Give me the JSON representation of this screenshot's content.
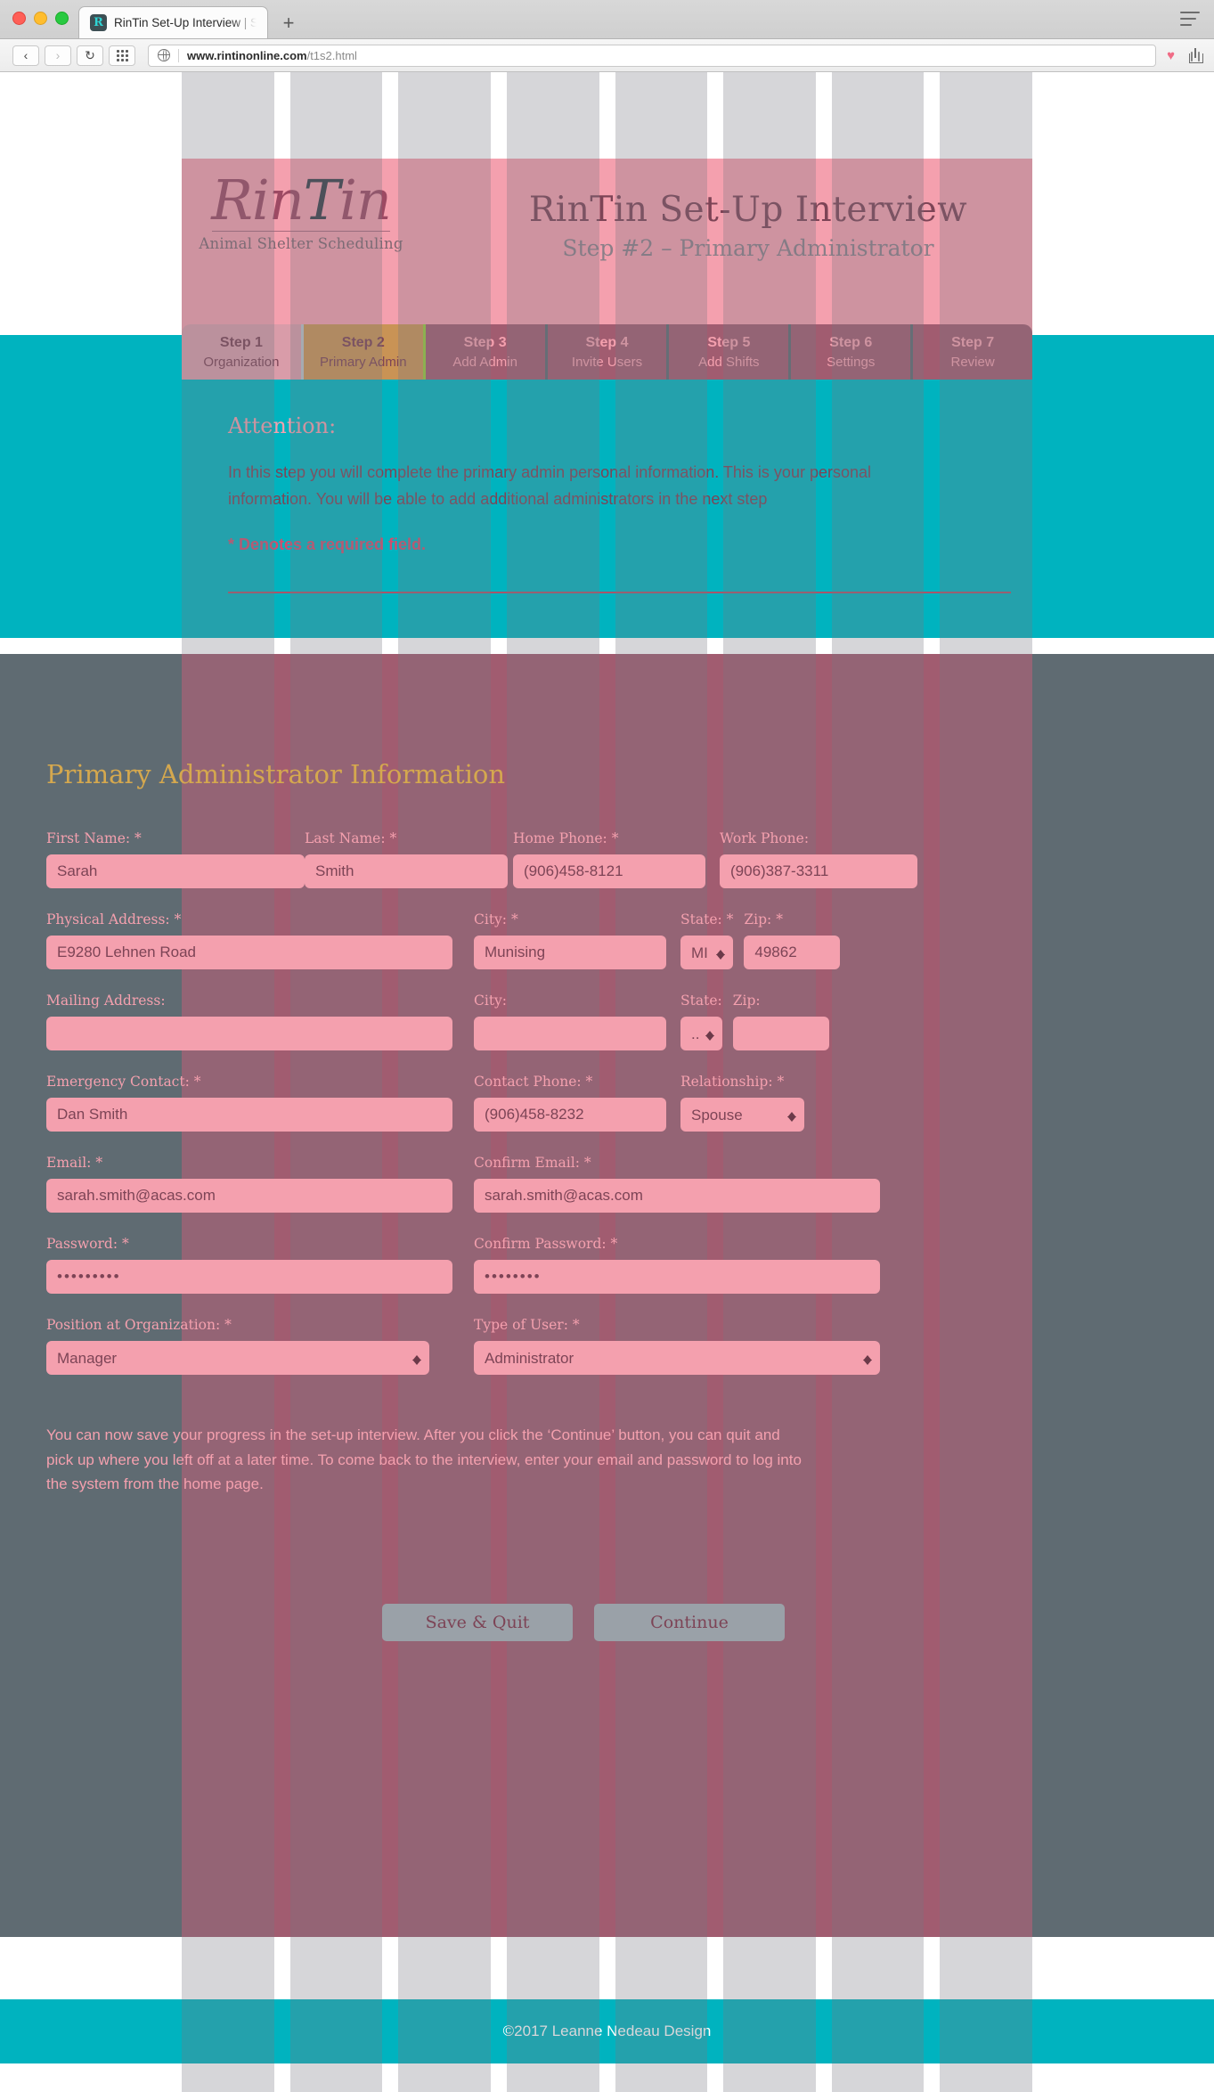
{
  "browser": {
    "tab_title": "RinTin Set-Up Interview | Step",
    "favicon_letter": "R",
    "new_tab_label": "+",
    "back_label": "‹",
    "forward_label": "›",
    "reload_label": "↻",
    "url_domain": "www.rintinonline.com",
    "url_path": "/t1s2.html",
    "bookmark_icon": "♥"
  },
  "header": {
    "logo_text": "RinTin",
    "logo_tagline": "Animal Shelter Scheduling",
    "title": "RinTin Set-Up Interview",
    "subtitle": "Step #2 – Primary Administrator"
  },
  "steps": [
    {
      "num": "Step 1",
      "label": "Organization",
      "state": "done"
    },
    {
      "num": "Step 2",
      "label": "Primary Admin",
      "state": "active"
    },
    {
      "num": "Step 3",
      "label": "Add Admin",
      "state": "todo"
    },
    {
      "num": "Step 4",
      "label": "Invite Users",
      "state": "todo"
    },
    {
      "num": "Step 5",
      "label": "Add Shifts",
      "state": "todo"
    },
    {
      "num": "Step 6",
      "label": "Settings",
      "state": "todo"
    },
    {
      "num": "Step 7",
      "label": "Review",
      "state": "todo"
    }
  ],
  "attention": {
    "title": "Attention:",
    "body": "In this step you will complete the primary admin personal information. This is your personal information. You will be able to add additional administrators in the next step",
    "required_note": "* Denotes a required field."
  },
  "form": {
    "heading": "Primary Administrator Information",
    "labels": {
      "first_name": "First Name: *",
      "last_name": "Last Name: *",
      "home_phone": "Home Phone: *",
      "work_phone": "Work Phone:",
      "physical_address": "Physical Address: *",
      "city_req": "City: *",
      "state_req": "State: *",
      "zip_req": "Zip: *",
      "mailing_address": "Mailing Address:",
      "city": "City:",
      "state": "State:",
      "zip": "Zip:",
      "emergency_contact": "Emergency Contact: *",
      "contact_phone": "Contact Phone: *",
      "relationship": "Relationship: *",
      "email": "Email: *",
      "confirm_email": "Confirm Email: *",
      "password": "Password: *",
      "confirm_password": "Confirm Password: *",
      "position": "Position at Organization: *",
      "user_type": "Type of User: *"
    },
    "values": {
      "first_name": "Sarah",
      "last_name": "Smith",
      "home_phone": "(906)458-8121",
      "work_phone": "(906)387-3311",
      "physical_address": "E9280 Lehnen Road",
      "city_req": "Munising",
      "state_req": "MI",
      "zip_req": "49862",
      "mailing_address": "",
      "city": "",
      "state": "...",
      "zip": "",
      "emergency_contact": "Dan Smith",
      "contact_phone": "(906)458-8232",
      "relationship": "Spouse",
      "email": "sarah.smith@acas.com",
      "confirm_email": "sarah.smith@acas.com",
      "password": "•••••••••",
      "confirm_password": "••••••••",
      "position": "Manager",
      "user_type": "Administrator"
    },
    "note": "You can now save your progress in the set-up interview. After you click the ‘Continue’ button, you can quit and pick up where you left off at a later time. To come back to the interview, enter your email and password to log into the system from the home page.",
    "save_button": "Save & Quit",
    "continue_button": "Continue"
  },
  "footer": {
    "copyright": "©2017 Leanne Nedeau Design"
  },
  "colors": {
    "pink": "#f4a0ae",
    "maroon": "#a15c70",
    "teal": "#00b3bf",
    "gold": "#d5a84e",
    "slate": "#5f6b72"
  }
}
